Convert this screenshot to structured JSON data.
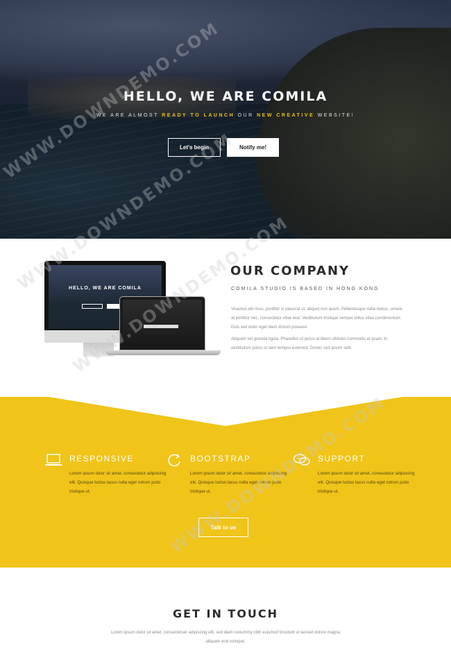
{
  "hero": {
    "title": "HELLO, WE ARE COMILA",
    "subtitle_parts": [
      "WE ARE ALMOST ",
      "READY TO LAUNCH",
      " OUR ",
      "NEW CREATIVE",
      " WEBSITE!"
    ],
    "btn_begin": "Let's begin",
    "btn_notify": "Notify me!"
  },
  "mockup": {
    "title": "HELLO, WE ARE COMILA"
  },
  "company": {
    "title": "OUR COMPANY",
    "subtitle": "COMILA STUDIO IS BASED IN HONG KONG",
    "p1": "Vivamus elit risus, porttitor in placerat ut, aliquet non quam. Pellentesque nulla metus, ornare at porttitor nec, consectetur vitae erat. Vestibulum tristique semper tellus vitae condimentum. Duis sed dolor eget diam dictum posuere.",
    "p2": "Aliquam vel gravida ligula. Phasellus ut purus at libero ultricies commodo at quam. In vestibulum purus ut sem tempus euismod. Donec sed ipsum velit."
  },
  "features": {
    "items": [
      {
        "title": "RESPONSIVE",
        "icon": "laptop-icon",
        "text": "Lorem ipsum dolor sit amet, consectetur adipiscing elit. Quisque luctus lacus nulla eget rutrum justo tristique ut."
      },
      {
        "title": "BOOTSTRAP",
        "icon": "refresh-icon",
        "text": "Lorem ipsum dolor sit amet, consectetur adipiscing elit. Quisque luctus lacus nulla eget rutrum justo tristique ut."
      },
      {
        "title": "SUPPORT",
        "icon": "chat-icon",
        "text": "Lorem ipsum dolor sit amet, consectetur adipiscing elit. Quisque luctus lacus nulla eget rutrum justo tristique ut."
      }
    ],
    "btn_talk": "Talk to us"
  },
  "contact": {
    "title": "GET IN TOUCH",
    "text": "Lorem ipsum dolor sit amet, consectetuer adipiscing elit, sed diam nonummy nibh euismod tincidunt ut laoreet dolore magna aliquam erat volutpat."
  },
  "colors": {
    "accent": "#f0c419",
    "dark_text": "#2b2b2b"
  },
  "watermark": "WWW.DOWNDEMO.COM"
}
